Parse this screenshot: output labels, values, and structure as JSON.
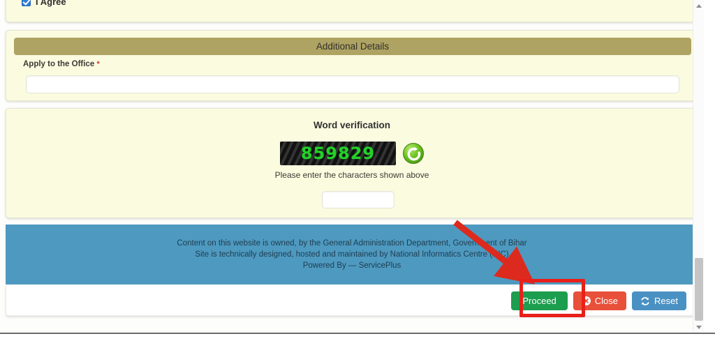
{
  "agree": {
    "label": "I Agree",
    "checked": true
  },
  "additional_details": {
    "section_title": "Additional Details",
    "office_label": "Apply to the Office",
    "required_marker": "*",
    "office_value": "",
    "office_placeholder": ""
  },
  "word_verification": {
    "title": "Word verification",
    "captcha_text": "859829",
    "refresh_icon": "refresh-icon",
    "hint": "Please enter the characters shown above",
    "input_value": "",
    "input_placeholder": ""
  },
  "footer": {
    "line1": "Content on this website is owned, by the General Administration Department, Government of Bihar",
    "line2": "Site is technically designed, hosted and maintained by National Informatics Centre (NIC)",
    "line3": "Powered By — ServicePlus"
  },
  "actions": {
    "proceed_label": "Proceed",
    "close_label": "Close",
    "close_icon": "close-circle-icon",
    "reset_label": "Reset",
    "reset_icon": "refresh-icon"
  },
  "annotation": {
    "highlight_color": "#e8201a",
    "arrow_color": "#dc2a1e",
    "target": "Proceed"
  },
  "colors": {
    "panel_bg": "#fbfbe0",
    "section_header": "#aea363",
    "footer_bg": "#4e99c0",
    "proceed_green": "#1d9d4e",
    "close_red": "#e8503a",
    "reset_blue": "#4a91c3",
    "captcha_green": "#22d128"
  },
  "scrollbar": {
    "up_icon": "caret-up-icon",
    "down_icon": "caret-down-icon"
  }
}
